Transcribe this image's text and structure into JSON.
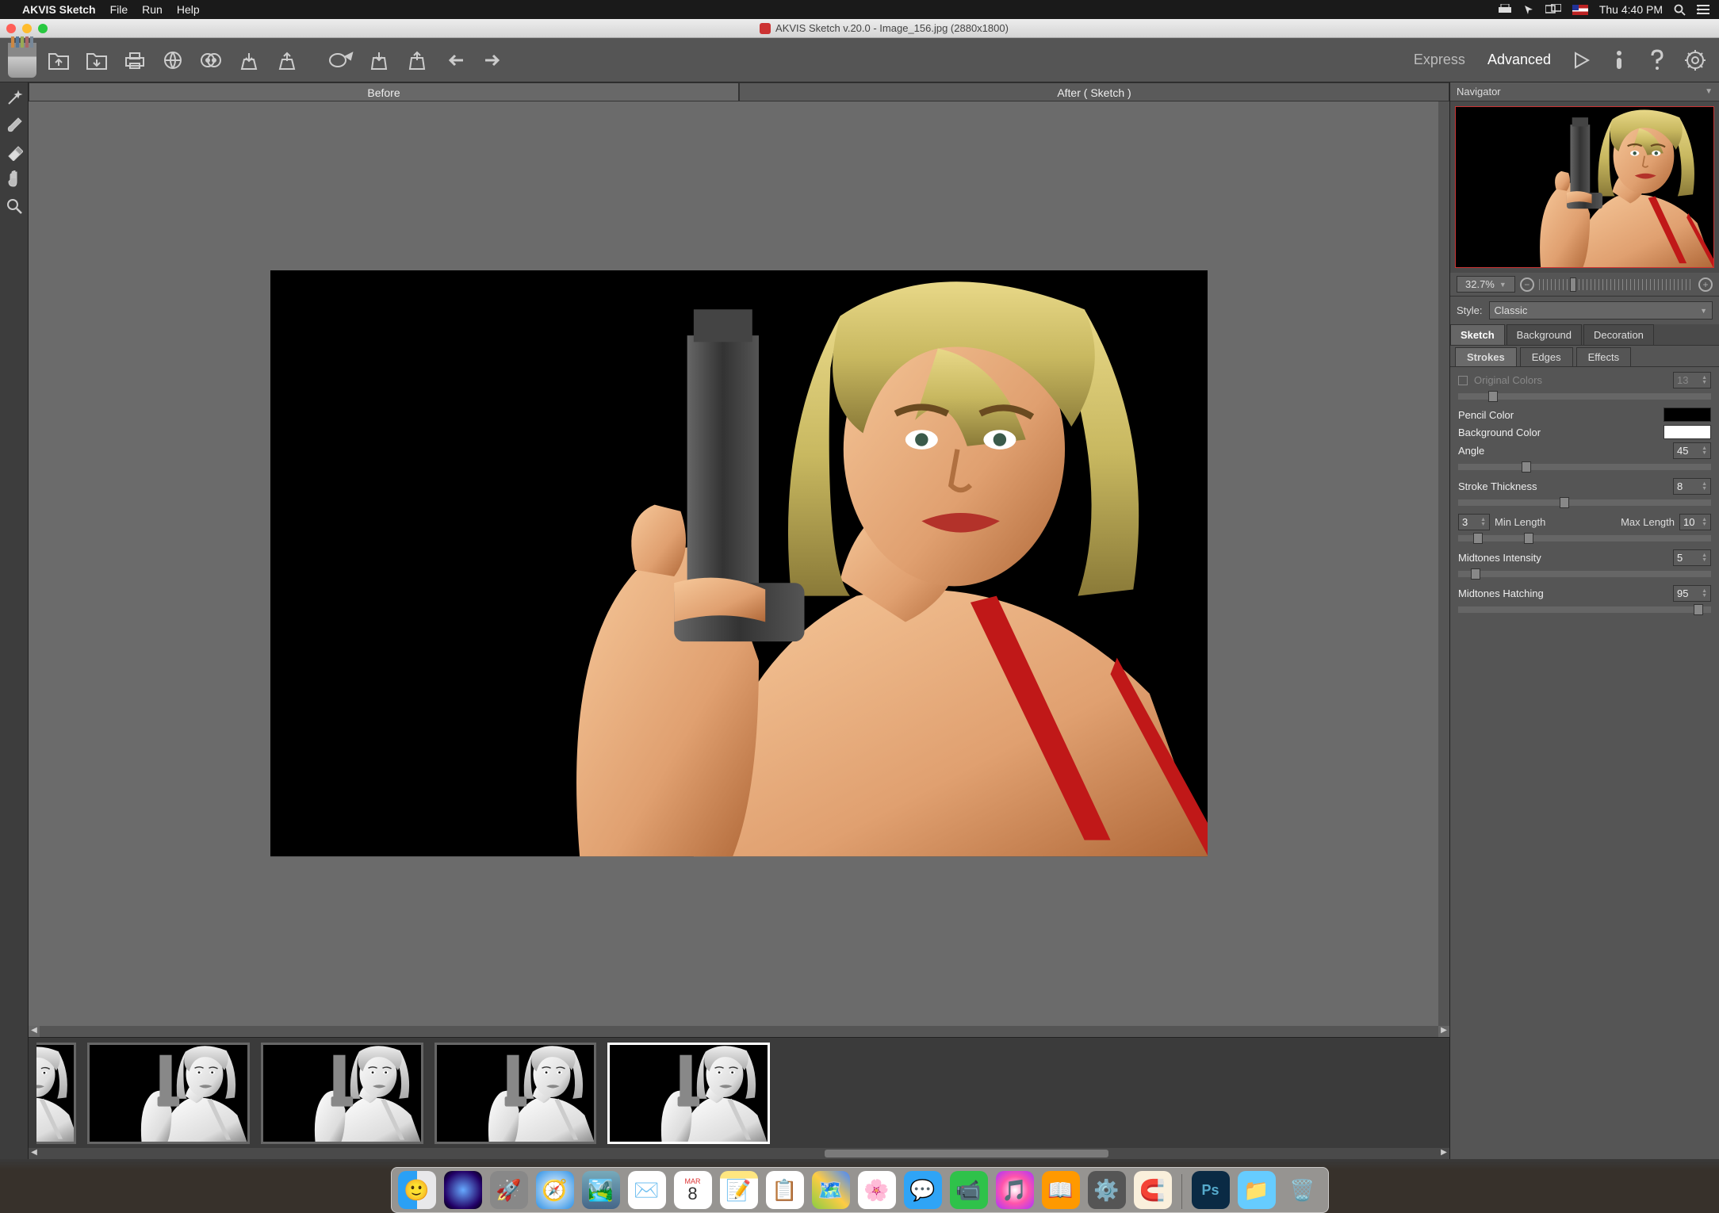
{
  "menubar": {
    "app_name": "AKVIS Sketch",
    "items": [
      "File",
      "Run",
      "Help"
    ],
    "clock": "Thu 4:40 PM"
  },
  "window": {
    "title": "AKVIS Sketch v.20.0 - Image_156.jpg (2880x1800)"
  },
  "modes": {
    "express": "Express",
    "advanced": "Advanced"
  },
  "view_tabs": {
    "before": "Before",
    "after": "After ( Sketch )"
  },
  "navigator": {
    "title": "Navigator",
    "zoom": "32.7%"
  },
  "style": {
    "label": "Style:",
    "value": "Classic"
  },
  "main_tabs": [
    "Sketch",
    "Background",
    "Decoration"
  ],
  "sub_tabs": [
    "Strokes",
    "Edges",
    "Effects"
  ],
  "controls": {
    "original_colors": {
      "label": "Original Colors",
      "value": "13"
    },
    "pencil_color": {
      "label": "Pencil Color",
      "color": "#000000"
    },
    "background_color": {
      "label": "Background Color",
      "color": "#ffffff"
    },
    "angle": {
      "label": "Angle",
      "value": "45"
    },
    "stroke_thickness": {
      "label": "Stroke Thickness",
      "value": "8"
    },
    "min_length": {
      "label": "Min Length",
      "value": "3"
    },
    "max_length": {
      "label": "Max Length",
      "value": "10"
    },
    "midtones_intensity": {
      "label": "Midtones Intensity",
      "value": "5"
    },
    "midtones_hatching": {
      "label": "Midtones Hatching",
      "value": "95"
    }
  },
  "dock": {
    "date_month": "MAR",
    "date_day": "8"
  }
}
